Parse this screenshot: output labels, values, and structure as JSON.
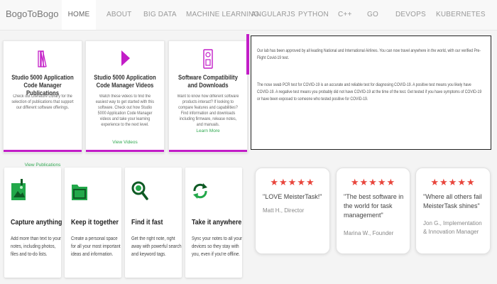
{
  "brand": "BogoToBogo",
  "nav": [
    {
      "label": "HOME",
      "active": true
    },
    {
      "label": "ABOUT"
    },
    {
      "label": "BIG DATA"
    },
    {
      "label": "MACHINE LEARNING"
    },
    {
      "label": "ANGULARJS"
    },
    {
      "label": "PYTHON"
    },
    {
      "label": "C++"
    },
    {
      "label": "GO"
    },
    {
      "label": "DEVOPS"
    },
    {
      "label": "KUBERNETES"
    }
  ],
  "cards": [
    {
      "icon": "books-icon",
      "title": "Studio 5000 Application Code Manager Publications",
      "body": "Check out Literature Library for the selection of publications that support our different software offerings.",
      "link": "View Publications"
    },
    {
      "icon": "play-icon",
      "title": "Studio 5000 Application Code Manager Videos",
      "body": "Watch these videos to find the easiest way to get started with this software. Check out how Studio 5000 Application Code Manager videos and take your learning experience to the next level.",
      "link": "View Videos"
    },
    {
      "icon": "compatibility-icon",
      "title": "Software Compatibility and Downloads",
      "body": "Want to know how different software products interact? If looking to compare features and capabilities? Find information and downloads including firmware, release notes, and manuals.",
      "link": "Learn More"
    }
  ],
  "notice": {
    "p1": "Our lab has been approved by all leading National and International Airlines. You can now travel anywhere in the world, with our verified Pre-Flight Covid-19 test.",
    "p2": "The nose swab PCR test for COVID-19 is an accurate and reliable test for diagnosing COVID-19. A positive test means you likely have COVID-19. A negative test means you probably did not have COVID-19 at the time of the test. Get tested if you have symptoms of COVID-19 or have been exposed to someone who tested positive for COVID-19."
  },
  "features": [
    {
      "icon": "capture-icon",
      "title": "Capture anything",
      "body": "Add more than text to your notes, including photos, files and to-do lists."
    },
    {
      "icon": "folder-icon",
      "title": "Keep it together",
      "body": "Create a personal space for all your most important ideas and information."
    },
    {
      "icon": "magnifier-icon",
      "title": "Find it fast",
      "body": "Get the right note, right away with powerful search and keyword tags."
    },
    {
      "icon": "sync-icon",
      "title": "Take it anywhere",
      "body": "Sync your notes to all your devices so they stay with you, even if you're offline."
    }
  ],
  "testimonials": [
    {
      "stars": "★★★★★",
      "quote": "\"LOVE MeisterTask!\"",
      "author": "Matt H., Director"
    },
    {
      "stars": "★★★★★",
      "quote": "\"The best software in the world for task management\"",
      "author": "Marina W., Founder"
    },
    {
      "stars": "★★★★★",
      "quote": "\"Where all others fail MeisterTask shines\"",
      "author": "Jon G., Implementation & Innovation Manager"
    }
  ],
  "colors": {
    "accent": "#c21dc7",
    "green": "#31a851",
    "star": "#e8453c"
  }
}
